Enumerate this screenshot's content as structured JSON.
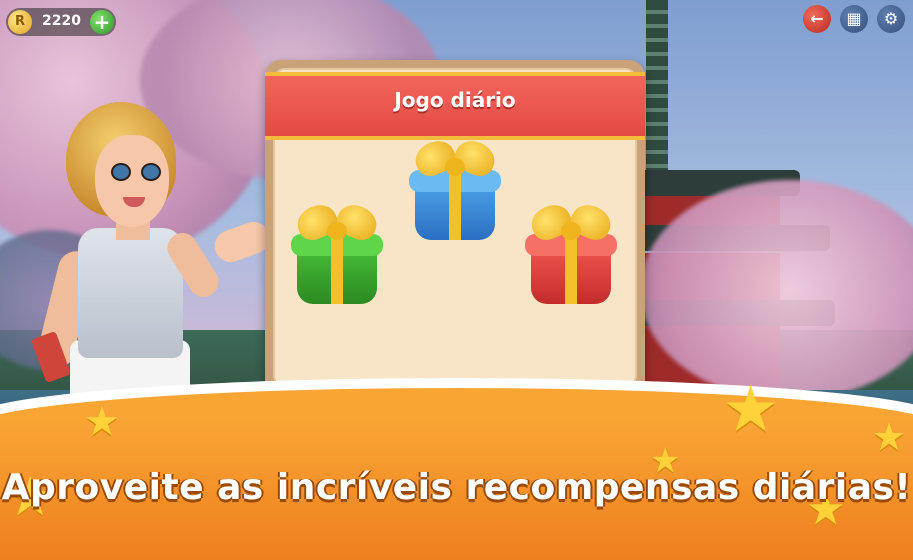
{
  "hud": {
    "coin_letter": "R",
    "coins": "2220",
    "add_icon": "plus-icon",
    "buttons": [
      "exit-icon",
      "grid-icon",
      "gear-icon"
    ]
  },
  "dialog": {
    "title": "Jogo diário",
    "gifts": [
      {
        "color": "green",
        "hex": "#3aae30"
      },
      {
        "color": "blue",
        "hex": "#3a8ed8"
      },
      {
        "color": "red",
        "hex": "#e04440"
      }
    ]
  },
  "banner": {
    "tagline": "Aproveite as incríveis recompensas diárias!"
  },
  "colors": {
    "title_bar": "#e9534b",
    "panel": "#f8e5c7",
    "banner_orange": "#f5952b"
  }
}
